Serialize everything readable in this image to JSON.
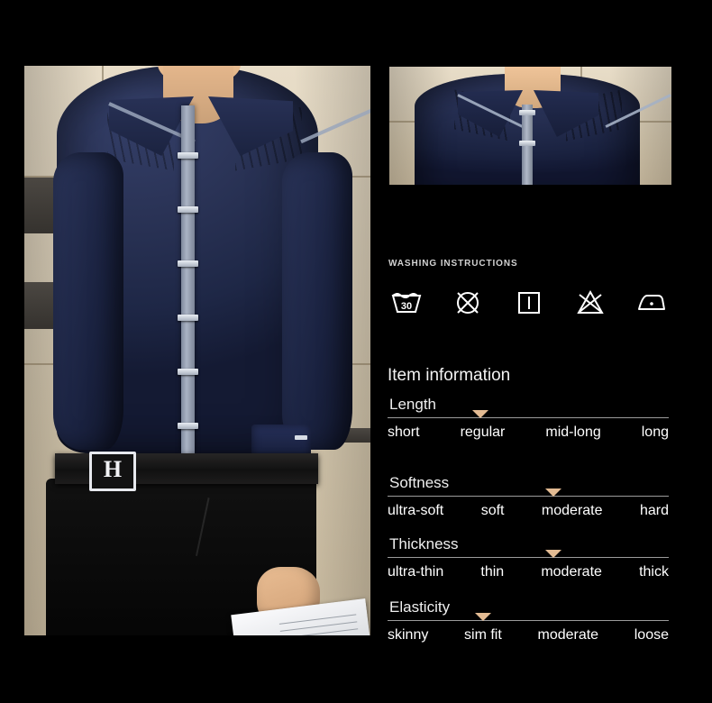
{
  "product": {
    "photos": [
      {
        "name": "model-wearing-navy-shirt-full",
        "alt": "Male model wearing navy blue long-sleeve dress shirt with black belt and black trousers holding white paper"
      },
      {
        "name": "shirt-collar-detail",
        "alt": "Close-up of navy shirt collar with grey piping and pleated shoulder detail"
      }
    ]
  },
  "washing": {
    "title": "WASHING INSTRUCTIONS",
    "icons": [
      {
        "name": "wash-30-icon",
        "label": "30"
      },
      {
        "name": "do-not-tumble-dry-icon",
        "label": ""
      },
      {
        "name": "drip-dry-icon",
        "label": ""
      },
      {
        "name": "do-not-bleach-icon",
        "label": ""
      },
      {
        "name": "iron-low-heat-icon",
        "label": ""
      }
    ]
  },
  "item_information": {
    "title": "Item information",
    "marker_color": "#e3bb93",
    "rail_color": "#9b9b9b",
    "specs": [
      {
        "category": "Length",
        "options": [
          "short",
          "regular",
          "mid-long",
          "long"
        ],
        "selected": "regular",
        "marker_percent": 33
      },
      {
        "category": "Softness",
        "options": [
          "ultra-soft",
          "soft",
          "moderate",
          "hard"
        ],
        "selected": "moderate",
        "marker_percent": 59
      },
      {
        "category": "Thickness",
        "options": [
          "ultra-thin",
          "thin",
          "moderate",
          "thick"
        ],
        "selected": "moderate",
        "marker_percent": 59
      },
      {
        "category": "Elasticity",
        "options": [
          "skinny",
          "sim fit",
          "moderate",
          "loose"
        ],
        "selected": "sim fit",
        "marker_percent": 34
      }
    ]
  }
}
